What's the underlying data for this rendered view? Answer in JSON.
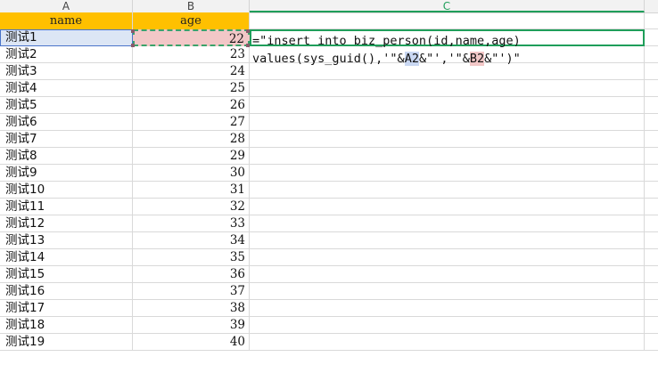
{
  "columns": [
    "A",
    "B",
    "C"
  ],
  "headers": {
    "name": "name",
    "age": "age"
  },
  "rows": [
    {
      "name": "测试1",
      "age": "22"
    },
    {
      "name": "测试2",
      "age": "23"
    },
    {
      "name": "测试3",
      "age": "24"
    },
    {
      "name": "测试4",
      "age": "25"
    },
    {
      "name": "测试5",
      "age": "26"
    },
    {
      "name": "测试6",
      "age": "27"
    },
    {
      "name": "测试7",
      "age": "28"
    },
    {
      "name": "测试8",
      "age": "29"
    },
    {
      "name": "测试9",
      "age": "30"
    },
    {
      "name": "测试10",
      "age": "31"
    },
    {
      "name": "测试11",
      "age": "32"
    },
    {
      "name": "测试12",
      "age": "33"
    },
    {
      "name": "测试13",
      "age": "34"
    },
    {
      "name": "测试14",
      "age": "35"
    },
    {
      "name": "测试15",
      "age": "36"
    },
    {
      "name": "测试16",
      "age": "37"
    },
    {
      "name": "测试17",
      "age": "38"
    },
    {
      "name": "测试18",
      "age": "39"
    },
    {
      "name": "测试19",
      "age": "40"
    }
  ],
  "formula": {
    "line1": "=\"insert into biz_person(id,name,age)",
    "line2_pre": "values(sys_guid(),'\"&",
    "ref_a": "A2",
    "line2_mid": "&\"','\"&",
    "ref_b": "B2",
    "line2_post": "&\"')\""
  },
  "colors": {
    "header_fill": "#ffc000",
    "active_column": "#1f9e5a",
    "ref_a_highlight": "#c9d7f2",
    "ref_b_highlight": "#f2c7c7"
  }
}
